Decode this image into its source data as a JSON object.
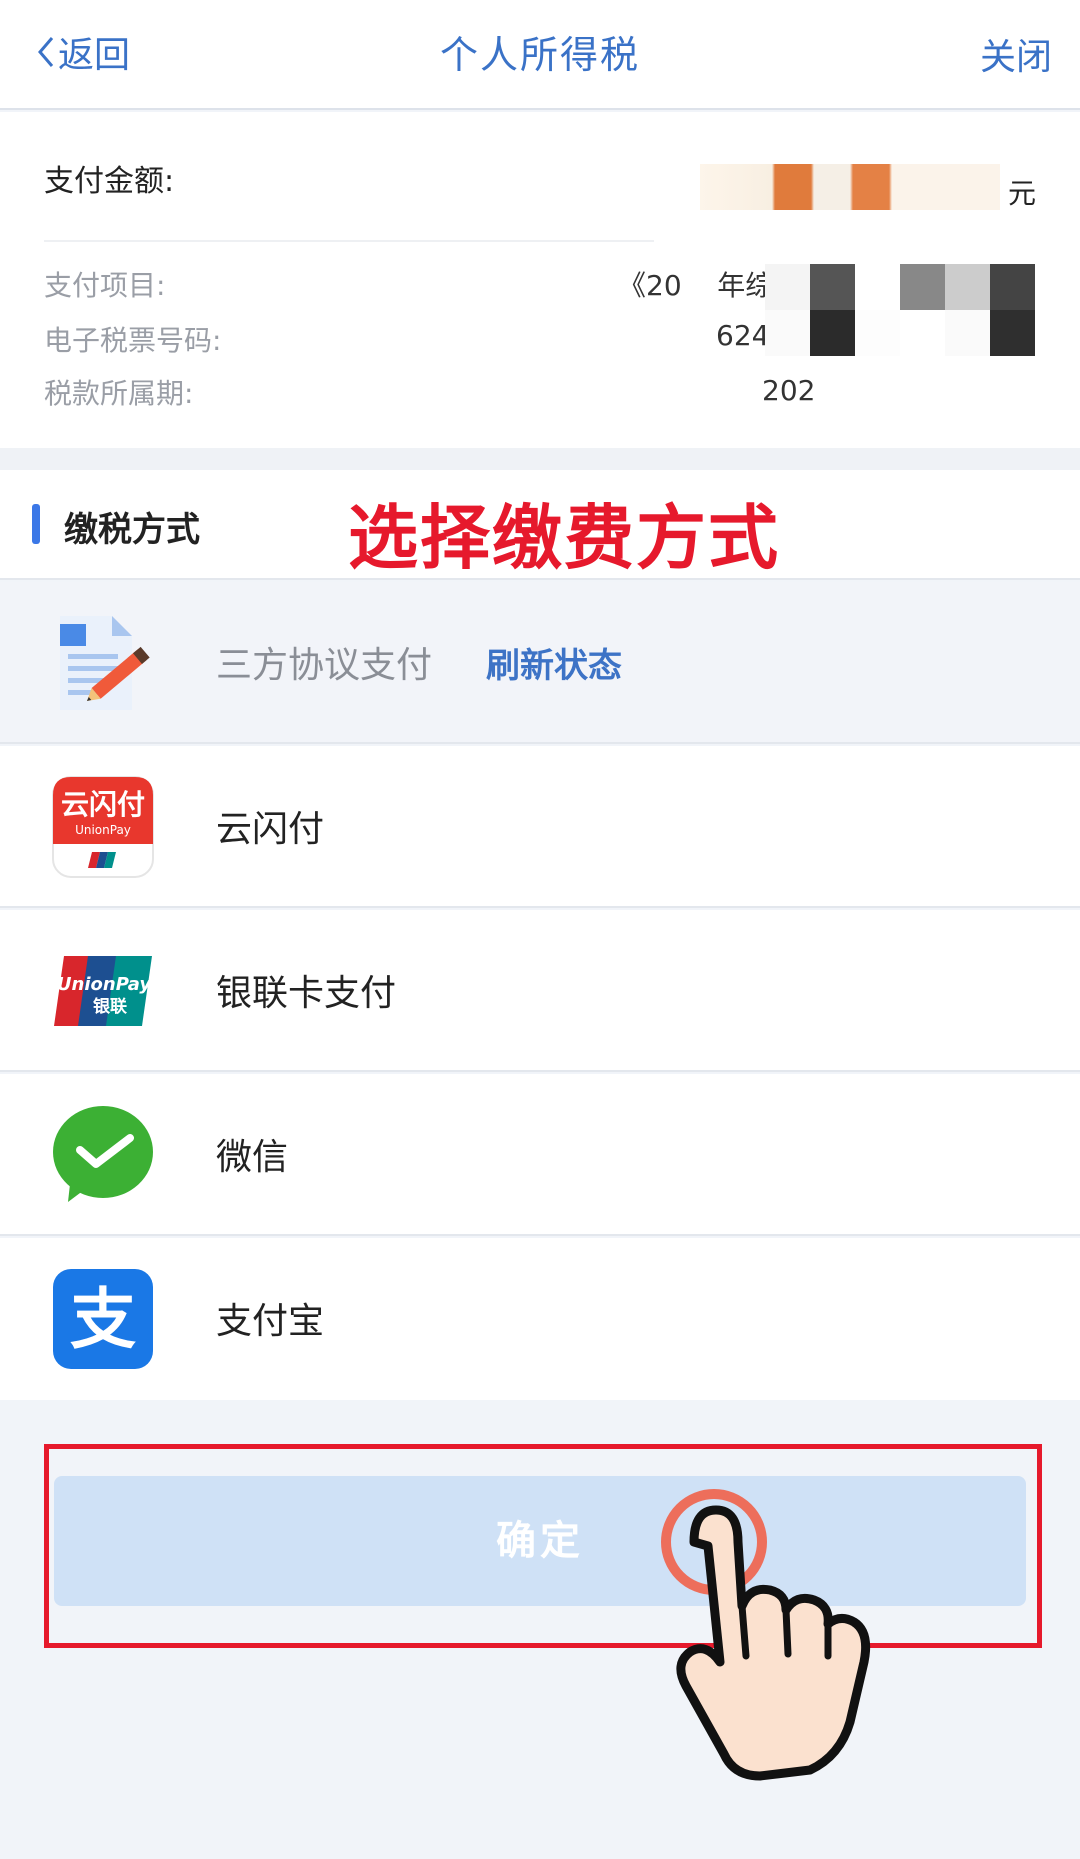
{
  "nav": {
    "back": "返回",
    "title": "个人所得税",
    "close": "关闭"
  },
  "payment": {
    "amount_label": "支付金额:",
    "amount_unit": "元",
    "rows": [
      {
        "label": "支付项目:",
        "value": "《20    年综合所"
      },
      {
        "label": "电子税票号码:",
        "value": "624032"
      },
      {
        "label": "税款所属期:",
        "value": "202"
      }
    ]
  },
  "section": {
    "label": "缴税方式",
    "overlay": "选择缴费方式"
  },
  "methods": [
    {
      "name": "三方协议支付",
      "link": "刷新状态",
      "icon": "document-pencil-icon",
      "enabled": false
    },
    {
      "name": "云闪付",
      "icon": "unionpay-quickpass-icon",
      "icon_text": "云闪付",
      "icon_subtext": "UnionPay",
      "enabled": true
    },
    {
      "name": "银联卡支付",
      "icon": "unionpay-card-icon",
      "icon_text": "UnionPay",
      "icon_subtext": "银联",
      "enabled": true
    },
    {
      "name": "微信",
      "icon": "wechat-pay-icon",
      "enabled": true
    },
    {
      "name": "支付宝",
      "icon": "alipay-icon",
      "icon_text": "支",
      "enabled": true
    }
  ],
  "confirm": {
    "label": "确定"
  },
  "colors": {
    "accent": "#3a72c7",
    "highlight_red": "#e6192c",
    "confirm_bg": "#cfe1f6"
  }
}
